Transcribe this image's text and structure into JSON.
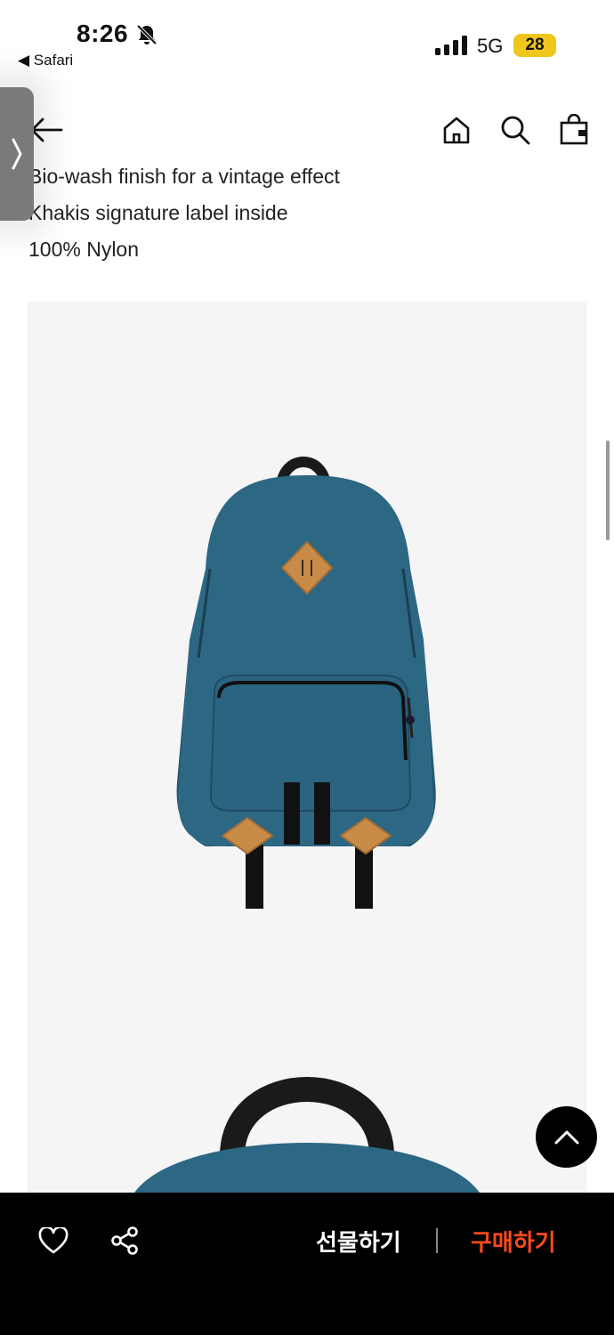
{
  "status_bar": {
    "time": "8:26",
    "back_app": "◀ Safari",
    "network": "5G",
    "battery": "28"
  },
  "description_lines": [
    "Bio-wash finish for a vintage effect",
    "Khakis signature label inside",
    "100% Nylon"
  ],
  "bottom_bar": {
    "gift_label": "선물하기",
    "buy_label": "구매하기"
  },
  "colors": {
    "accent": "#ff4a1c",
    "backpack": "#2c6784",
    "leather": "#c98c48",
    "battery": "#f0c51c"
  },
  "icons": [
    "bell-slash-icon",
    "signal-icon",
    "back-arrow-icon",
    "home-icon",
    "search-icon",
    "shopping-bag-icon",
    "chevron-right-icon",
    "chevron-up-icon",
    "heart-icon",
    "share-icon"
  ]
}
